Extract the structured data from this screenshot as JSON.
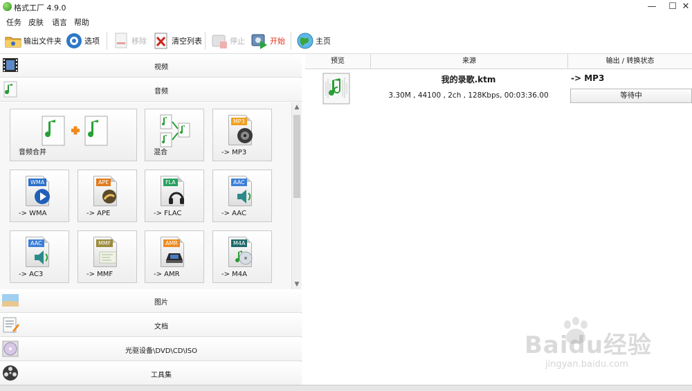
{
  "window": {
    "title": "格式工厂 4.9.0",
    "minimize": "—",
    "maximize": "☐",
    "close": "✕"
  },
  "menu": [
    "任务",
    "皮肤",
    "语言",
    "帮助"
  ],
  "toolbar": {
    "output_folder": "输出文件夹",
    "options": "选项",
    "remove": "移除",
    "clear_list": "清空列表",
    "stop": "停止",
    "start": "开始",
    "home": "主页"
  },
  "categories": {
    "video": "视频",
    "audio": "音频",
    "picture": "图片",
    "document": "文档",
    "optical": "光驱设备\\DVD\\CD\\ISO",
    "tools": "工具集"
  },
  "audio_tiles": [
    {
      "label": "音频合并",
      "badge": ""
    },
    {
      "label": "混合",
      "badge": ""
    },
    {
      "label": "-> MP3",
      "badge": "MP3",
      "color": "#f0a020"
    },
    {
      "label": "-> WMA",
      "badge": "WMA",
      "color": "#2a6fc9"
    },
    {
      "label": "-> APE",
      "badge": "APE",
      "color": "#e07a1a"
    },
    {
      "label": "-> FLAC",
      "badge": "FLA",
      "color": "#2aa060"
    },
    {
      "label": "-> AAC",
      "badge": "AAC",
      "color": "#3c7fd8"
    },
    {
      "label": "-> AC3",
      "badge": "AAC",
      "color": "#3c7fd8"
    },
    {
      "label": "-> MMF",
      "badge": "MMF",
      "color": "#9a8a3a"
    },
    {
      "label": "-> AMR",
      "badge": "AMR",
      "color": "#f08a20"
    },
    {
      "label": "-> M4A",
      "badge": "M4A",
      "color": "#1f6a6a"
    }
  ],
  "table": {
    "headers": [
      "预览",
      "来源",
      "输出 / 转换状态"
    ],
    "rows": [
      {
        "file_name": "我的录歌.ktm",
        "file_info": "3.30M , 44100 , 2ch , 128Kbps, 00:03:36.00",
        "output": "-> MP3",
        "status": "等待中"
      }
    ]
  },
  "watermark": {
    "main": "Baidu经验",
    "sub": "jingyan.baidu.com"
  },
  "colors": {
    "start_text": "#e0311c",
    "note_green": "#1f9b2e"
  }
}
